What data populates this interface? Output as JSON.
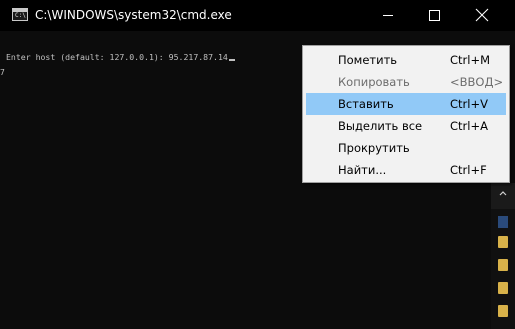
{
  "window": {
    "title": "C:\\WINDOWS\\system32\\cmd.exe",
    "app_icon": "cmd-console-icon",
    "app_icon_text": "C:\\",
    "controls": {
      "minimize_icon": "minimize-icon",
      "maximize_icon": "maximize-icon",
      "close_icon": "close-icon"
    }
  },
  "terminal": {
    "prompt_line": "Enter host (default: 127.0.0.1): 95.217.87.14",
    "left_fragment": "7",
    "text_color": "#c0c0c0",
    "background": "#0c0c0c"
  },
  "context_menu": {
    "items": [
      {
        "label": "Пометить",
        "shortcut": "Ctrl+M",
        "enabled": true,
        "highlighted": false
      },
      {
        "label": "Копировать",
        "shortcut": "<ВВОД>",
        "enabled": false,
        "highlighted": false
      },
      {
        "label": "Вставить",
        "shortcut": "Ctrl+V",
        "enabled": true,
        "highlighted": true
      },
      {
        "label": "Выделить все",
        "shortcut": "Ctrl+A",
        "enabled": true,
        "highlighted": false
      },
      {
        "label": "Прокрутить",
        "shortcut": "",
        "enabled": true,
        "highlighted": false
      },
      {
        "label": "Найти...",
        "shortcut": "Ctrl+F",
        "enabled": true,
        "highlighted": false
      }
    ],
    "highlight_color": "#91c9f7"
  },
  "background_window": {
    "icons": [
      "scroll-arrow-icon",
      "image-thumbnail-icon",
      "folder-icon",
      "folder-icon",
      "folder-icon",
      "folder-icon"
    ]
  }
}
